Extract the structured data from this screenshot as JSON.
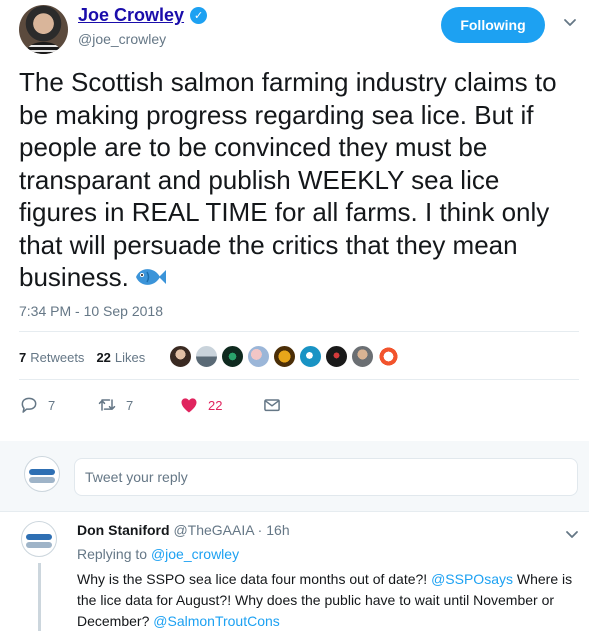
{
  "author": {
    "name": "Joe Crowley",
    "handle": "@joe_crowley",
    "follow_label": "Following"
  },
  "tweet": {
    "text": "The Scottish salmon farming industry claims to be making progress regarding sea lice. But if people are to be convinced they must be transparant and publish WEEKLY sea lice figures in REAL TIME for all farms. I think only that will persuade the critics that they mean business.",
    "emoji": "fish",
    "timestamp": "7:34 PM - 10 Sep 2018"
  },
  "stats": {
    "retweets_count": "7",
    "retweets_label": "Retweets",
    "likes_count": "22",
    "likes_label": "Likes"
  },
  "actions": {
    "reply_count": "7",
    "retweet_count": "7",
    "like_count": "22"
  },
  "colors": {
    "accent": "#1da1f2",
    "like": "#e0245e",
    "name_link": "#1a0dab"
  },
  "reply_box": {
    "placeholder": "Tweet your reply"
  },
  "reply": {
    "name": "Don Staniford",
    "handle": "@TheGAAIA",
    "separator": " · ",
    "time": "16h",
    "replying_prefix": "Replying to ",
    "replying_handle": "@joe_crowley",
    "text_part1": "Why is the SSPO sea lice data four months out of date?! ",
    "mention1": "@SSPOsays",
    "text_part2": " Where is the lice data for August?!  Why does the public have to wait until November or December? ",
    "mention2": "@SalmonTroutCons"
  }
}
